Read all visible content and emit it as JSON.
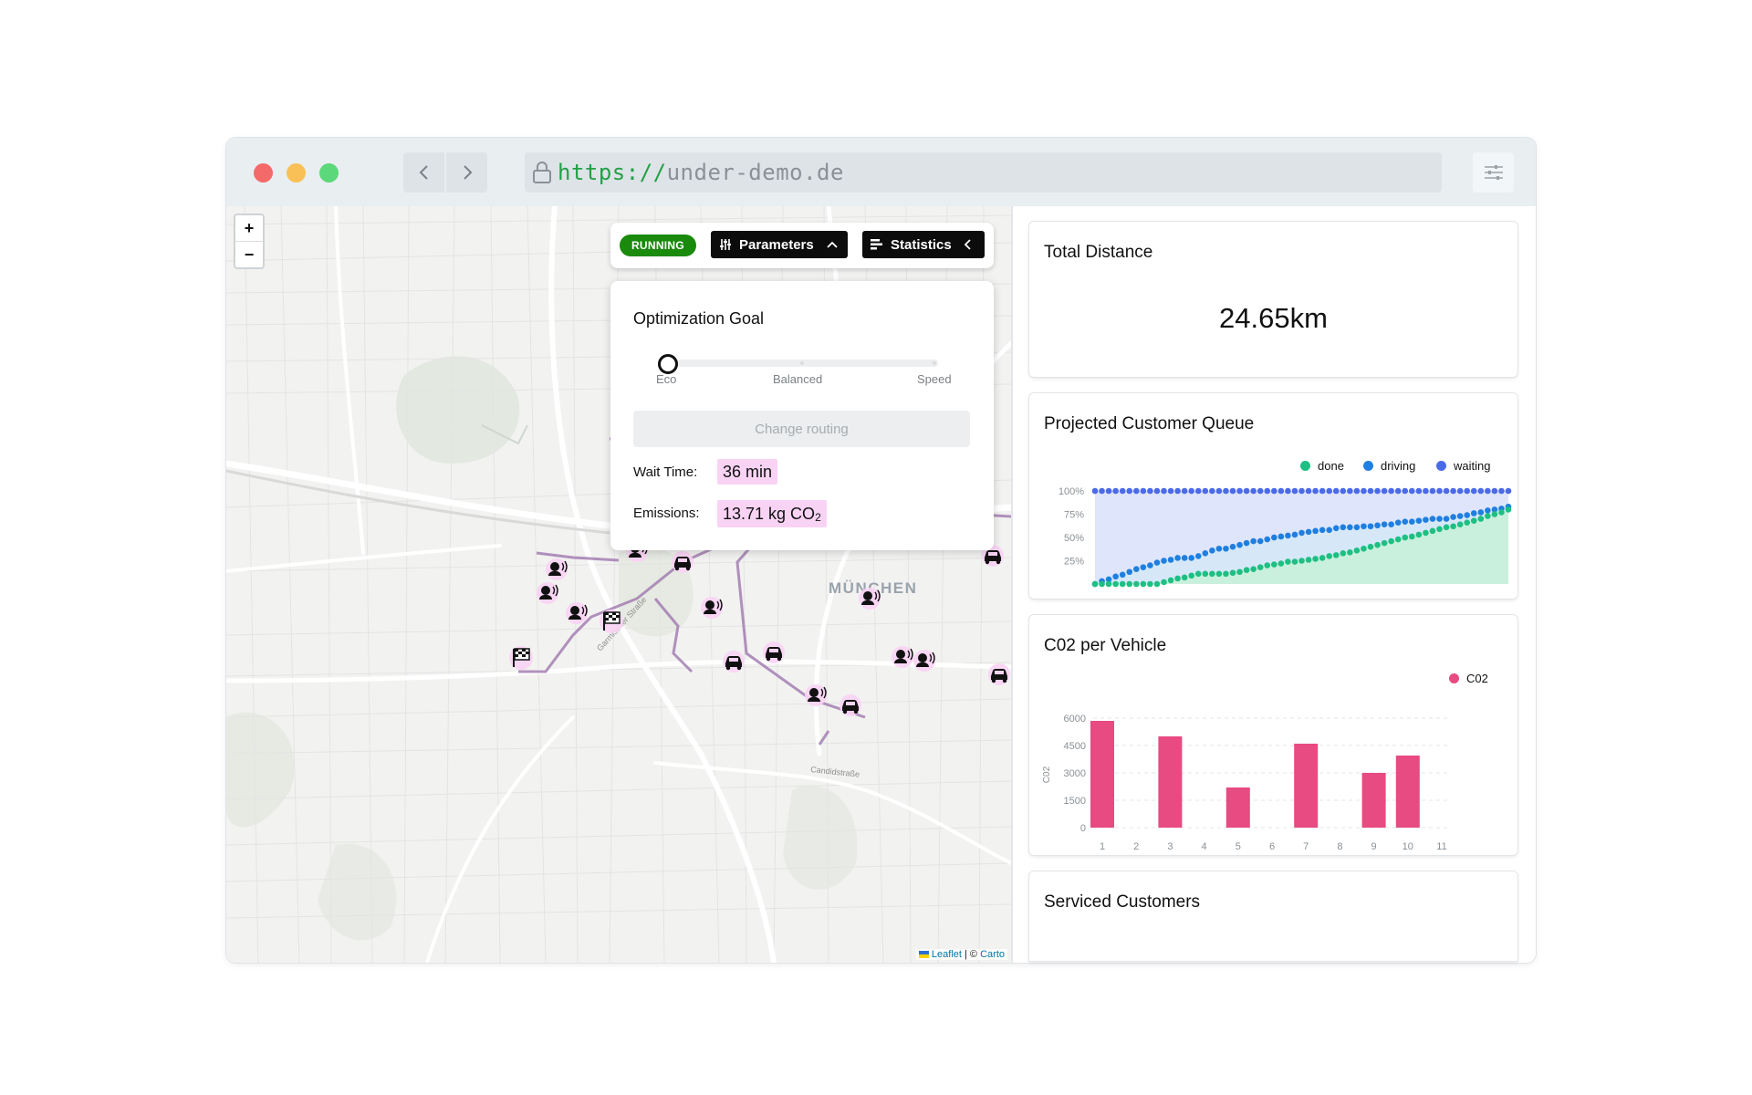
{
  "browser": {
    "url_scheme": "https://",
    "url_host": "under-demo.de",
    "back_icon": "chevron-left-icon",
    "forward_icon": "chevron-right-icon",
    "lock_icon": "lock-icon",
    "settings_icon": "sliders-icon"
  },
  "map": {
    "zoom_in": "+",
    "zoom_out": "−",
    "city_label": "MÜNCHEN",
    "street_labels": [
      "Garmischer Straße",
      "Candidstraße"
    ],
    "attribution_leaflet": "Leaflet",
    "attribution_sep": " | © ",
    "attribution_carto": "Carto",
    "markers": [
      {
        "type": "customer-waiting"
      },
      {
        "type": "customer-waiting"
      },
      {
        "type": "customer-waiting"
      },
      {
        "type": "customer-waiting"
      },
      {
        "type": "customer-waiting"
      },
      {
        "type": "customer-waiting"
      },
      {
        "type": "customer-waiting"
      },
      {
        "type": "customer-waiting"
      },
      {
        "type": "customer-waiting"
      },
      {
        "type": "vehicle"
      },
      {
        "type": "vehicle"
      },
      {
        "type": "vehicle"
      },
      {
        "type": "vehicle"
      },
      {
        "type": "vehicle"
      },
      {
        "type": "vehicle"
      },
      {
        "type": "finish-flag"
      },
      {
        "type": "finish-flag"
      }
    ]
  },
  "toolbar": {
    "status": "RUNNING",
    "status_color": "#1a8a0c",
    "parameters_label": "Parameters",
    "statistics_label": "Statistics"
  },
  "parameters_panel": {
    "title": "Optimization Goal",
    "slider_options": [
      "Eco",
      "Balanced",
      "Speed"
    ],
    "slider_selected": "Eco",
    "change_routing_label": "Change routing",
    "wait_time_label": "Wait Time:",
    "wait_time_value": "36 min",
    "emissions_label": "Emissions:",
    "emissions_value": "13.71 kg CO",
    "emissions_subscript": "2"
  },
  "cards": {
    "total_distance": {
      "title": "Total Distance",
      "value": "24.65km"
    },
    "queue": {
      "title": "Projected Customer Queue"
    },
    "co2": {
      "title": "C02 per Vehicle"
    },
    "serviced": {
      "title": "Serviced Customers"
    }
  },
  "chart_data": [
    {
      "type": "area",
      "legend": [
        "done",
        "driving",
        "waiting"
      ],
      "colors": {
        "done": "#1fbf83",
        "driving": "#1f7fe0",
        "waiting": "#4a6ae8"
      },
      "y_ticks": [
        "100%",
        "75%",
        "50%",
        "25%"
      ],
      "ylim": [
        0,
        100
      ],
      "x": [
        1,
        2,
        3,
        4,
        5,
        6,
        7,
        8,
        9,
        10,
        11,
        12,
        13,
        14,
        15,
        16,
        17,
        18,
        19,
        20,
        21,
        22,
        23,
        24,
        25,
        26,
        27,
        28,
        29,
        30,
        31,
        32,
        33,
        34,
        35,
        36,
        37,
        38,
        39,
        40,
        41,
        42,
        43,
        44,
        45,
        46,
        47,
        48,
        49,
        50,
        51,
        52,
        53,
        54,
        55,
        56,
        57,
        58,
        59,
        60,
        61
      ],
      "series": [
        {
          "name": "waiting",
          "values": [
            100,
            100,
            100,
            100,
            100,
            100,
            100,
            100,
            100,
            100,
            100,
            100,
            100,
            100,
            100,
            100,
            100,
            100,
            100,
            100,
            100,
            100,
            100,
            100,
            100,
            100,
            100,
            100,
            100,
            100,
            100,
            100,
            100,
            100,
            100,
            100,
            100,
            100,
            100,
            100,
            100,
            100,
            100,
            100,
            100,
            100,
            100,
            100,
            100,
            100,
            100,
            100,
            100,
            100,
            100,
            100,
            100,
            100,
            100,
            100,
            100
          ]
        },
        {
          "name": "driving",
          "values": [
            0,
            3,
            5,
            8,
            10,
            13,
            16,
            18,
            20,
            23,
            25,
            26,
            28,
            28,
            28,
            30,
            33,
            36,
            38,
            38,
            40,
            42,
            44,
            46,
            46,
            48,
            50,
            51,
            52,
            53,
            55,
            56,
            57,
            58,
            58,
            60,
            61,
            61,
            61,
            62,
            62,
            63,
            64,
            64,
            66,
            67,
            67,
            68,
            69,
            70,
            70,
            70,
            72,
            73,
            74,
            76,
            77,
            79,
            80,
            81,
            83
          ]
        },
        {
          "name": "done",
          "values": [
            0,
            0,
            0,
            0,
            0,
            0,
            0,
            0,
            0,
            0,
            2,
            4,
            6,
            7,
            9,
            11,
            11,
            11,
            11,
            11,
            12,
            13,
            15,
            16,
            18,
            20,
            21,
            22,
            24,
            24,
            25,
            26,
            27,
            28,
            30,
            31,
            33,
            34,
            36,
            38,
            40,
            42,
            44,
            46,
            48,
            50,
            51,
            53,
            55,
            57,
            59,
            61,
            62,
            64,
            66,
            68,
            70,
            73,
            75,
            77,
            80
          ]
        }
      ]
    },
    {
      "type": "bar",
      "legend": [
        "C02"
      ],
      "color": "#e84a82",
      "ylabel": "C02",
      "categories": [
        "1",
        "2",
        "3",
        "4",
        "5",
        "6",
        "7",
        "8",
        "9",
        "10",
        "11"
      ],
      "y_ticks": [
        "6000",
        "4500",
        "3000",
        "1500",
        "0"
      ],
      "ylim": [
        0,
        6000
      ],
      "series": [
        {
          "name": "C02",
          "values": [
            5850,
            0,
            5000,
            0,
            2200,
            0,
            4600,
            0,
            3000,
            3950,
            0
          ]
        }
      ]
    }
  ]
}
